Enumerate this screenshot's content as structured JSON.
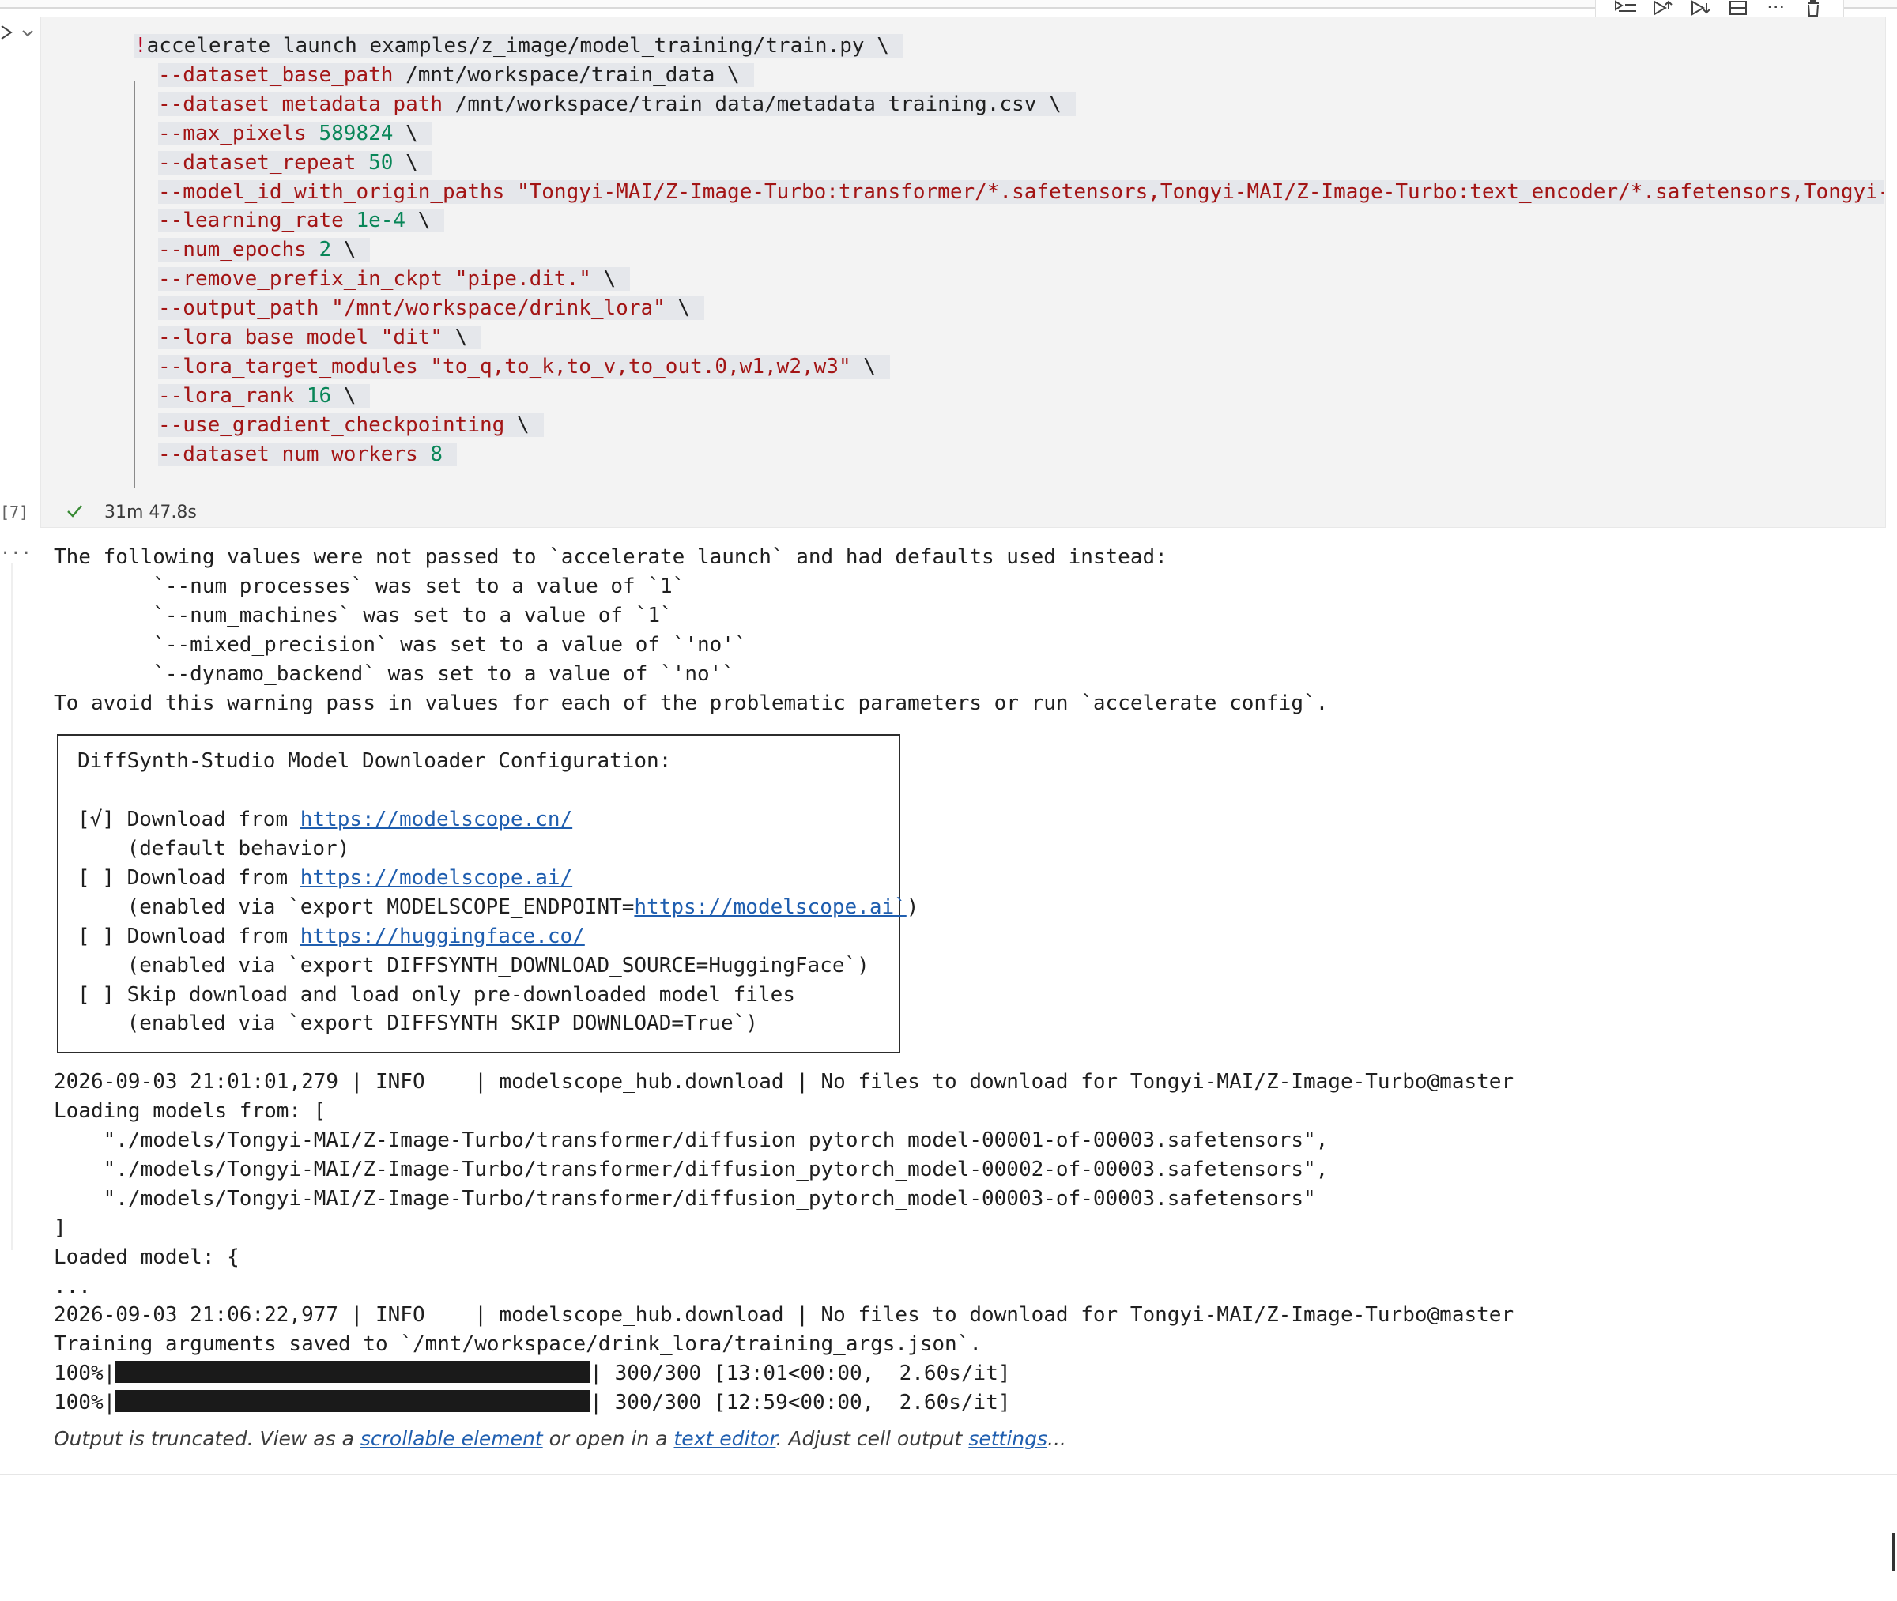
{
  "toolbar": {
    "buttons": [
      "run-by-line-icon",
      "execute-above-icon",
      "execute-below-icon",
      "split-cell-icon",
      "more-actions-icon",
      "delete-cell-icon"
    ],
    "more_label": "···"
  },
  "cell": {
    "execution_count": "[7]",
    "status": "success",
    "duration": "31m 47.8s",
    "code": [
      [
        [
          "excl",
          "!"
        ],
        [
          "text",
          "accelerate launch examples/z_image/model_training/train.py \\"
        ]
      ],
      [
        [
          "flag",
          "--dataset_base_path"
        ],
        [
          "text",
          " /mnt/workspace/train_data \\"
        ]
      ],
      [
        [
          "flag",
          "--dataset_metadata_path"
        ],
        [
          "text",
          " /mnt/workspace/train_data/metadata_training.csv \\"
        ]
      ],
      [
        [
          "flag",
          "--max_pixels"
        ],
        [
          "text",
          " "
        ],
        [
          "num",
          "589824"
        ],
        [
          "text",
          " \\"
        ]
      ],
      [
        [
          "flag",
          "--dataset_repeat"
        ],
        [
          "text",
          " "
        ],
        [
          "num",
          "50"
        ],
        [
          "text",
          " \\"
        ]
      ],
      [
        [
          "flag",
          "--model_id_with_origin_paths"
        ],
        [
          "text",
          " "
        ],
        [
          "str",
          "\"Tongyi-MAI/Z-Image-Turbo:transformer/*.safetensors,Tongyi-MAI/Z-Image-Turbo:text_encoder/*.safetensors,Tongyi-MAI/Z-Imag"
        ]
      ],
      [
        [
          "flag",
          "--learning_rate"
        ],
        [
          "text",
          " "
        ],
        [
          "num",
          "1e-4"
        ],
        [
          "text",
          " \\"
        ]
      ],
      [
        [
          "flag",
          "--num_epochs"
        ],
        [
          "text",
          " "
        ],
        [
          "num",
          "2"
        ],
        [
          "text",
          " \\"
        ]
      ],
      [
        [
          "flag",
          "--remove_prefix_in_ckpt"
        ],
        [
          "text",
          " "
        ],
        [
          "str",
          "\"pipe.dit.\""
        ],
        [
          "text",
          " \\"
        ]
      ],
      [
        [
          "flag",
          "--output_path"
        ],
        [
          "text",
          " "
        ],
        [
          "str",
          "\"/mnt/workspace/drink_lora\""
        ],
        [
          "text",
          " \\"
        ]
      ],
      [
        [
          "flag",
          "--lora_base_model"
        ],
        [
          "text",
          " "
        ],
        [
          "str",
          "\"dit\""
        ],
        [
          "text",
          " \\"
        ]
      ],
      [
        [
          "flag",
          "--lora_target_modules"
        ],
        [
          "text",
          " "
        ],
        [
          "str",
          "\"to_q,to_k,to_v,to_out.0,w1,w2,w3\""
        ],
        [
          "text",
          " \\"
        ]
      ],
      [
        [
          "flag",
          "--lora_rank"
        ],
        [
          "text",
          " "
        ],
        [
          "num",
          "16"
        ],
        [
          "text",
          " \\"
        ]
      ],
      [
        [
          "flag",
          "--use_gradient_checkpointing"
        ],
        [
          "text",
          " \\"
        ]
      ],
      [
        [
          "flag",
          "--dataset_num_workers"
        ],
        [
          "text",
          " "
        ],
        [
          "num",
          "8"
        ]
      ]
    ]
  },
  "output": {
    "ellipsis": "···",
    "warning": [
      "The following values were not passed to `accelerate launch` and had defaults used instead:",
      "        `--num_processes` was set to a value of `1`",
      "        `--num_machines` was set to a value of `1`",
      "        `--mixed_precision` was set to a value of `'no'`",
      "        `--dynamo_backend` was set to a value of `'no'`",
      "To avoid this warning pass in values for each of the problematic parameters or run `accelerate config`."
    ],
    "box": {
      "title": "DiffSynth-Studio Model Downloader Configuration:",
      "options": [
        {
          "mark": "[√]",
          "text": " Download from ",
          "link": "https://modelscope.cn/",
          "note_prefix": "    (default behavior)",
          "note_link": "",
          "note_suffix": ""
        },
        {
          "mark": "[ ]",
          "text": " Download from ",
          "link": "https://modelscope.ai/",
          "note_prefix": "    (enabled via `export MODELSCOPE_ENDPOINT=",
          "note_link": "https://modelscope.ai`",
          "note_suffix": ")"
        },
        {
          "mark": "[ ]",
          "text": " Download from ",
          "link": "https://huggingface.co/",
          "note_prefix": "    (enabled via `export DIFFSYNTH_DOWNLOAD_SOURCE=HuggingFace`)",
          "note_link": "",
          "note_suffix": ""
        },
        {
          "mark": "[ ]",
          "text": " Skip download and load only pre-downloaded model files",
          "link": "",
          "note_prefix": "    (enabled via `export DIFFSYNTH_SKIP_DOWNLOAD=True`)",
          "note_link": "",
          "note_suffix": ""
        }
      ]
    },
    "log": [
      "2026-09-03 21:01:01,279 | INFO    | modelscope_hub.download | No files to download for Tongyi-MAI/Z-Image-Turbo@master",
      "Loading models from: [",
      "    \"./models/Tongyi-MAI/Z-Image-Turbo/transformer/diffusion_pytorch_model-00001-of-00003.safetensors\",",
      "    \"./models/Tongyi-MAI/Z-Image-Turbo/transformer/diffusion_pytorch_model-00002-of-00003.safetensors\",",
      "    \"./models/Tongyi-MAI/Z-Image-Turbo/transformer/diffusion_pytorch_model-00003-of-00003.safetensors\"",
      "]",
      "Loaded model: {",
      "...",
      "2026-09-03 21:06:22,977 | INFO    | modelscope_hub.download | No files to download for Tongyi-MAI/Z-Image-Turbo@master",
      "Training arguments saved to `/mnt/workspace/drink_lora/training_args.json`."
    ],
    "progress": [
      {
        "pct": "100%|",
        "fraction": 1.0,
        "after": "| 300/300 [13:01<00:00,  2.60s/it]"
      },
      {
        "pct": "100%|",
        "fraction": 1.0,
        "after": "| 300/300 [12:59<00:00,  2.60s/it]"
      }
    ],
    "truncated": {
      "prefix": "Output is truncated. View as a ",
      "link1": "scrollable element",
      "mid1": " or open in a ",
      "link2": "text editor",
      "mid2": ". Adjust cell output ",
      "link3": "settings",
      "suffix": "..."
    }
  }
}
